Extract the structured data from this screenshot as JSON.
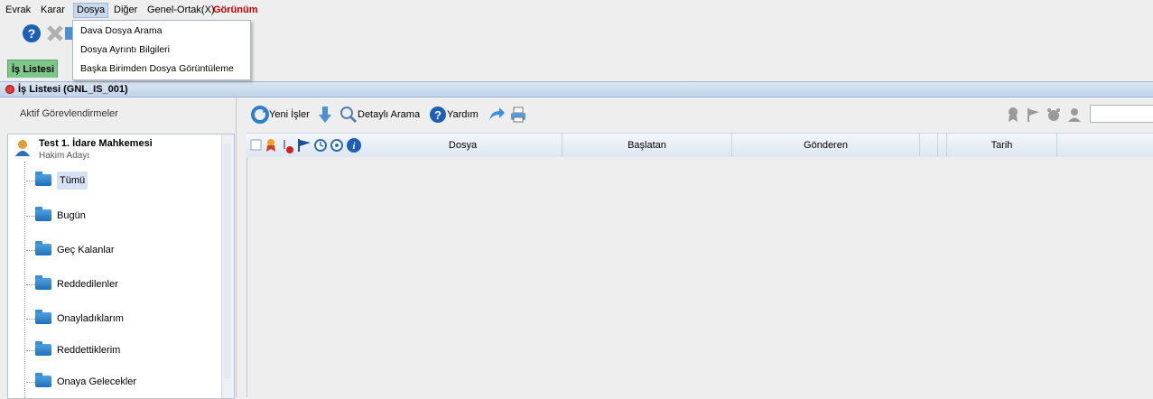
{
  "menu": {
    "items": [
      {
        "label": "Evrak"
      },
      {
        "label": "Karar"
      },
      {
        "label": "Dosya"
      },
      {
        "label": "Diğer"
      },
      {
        "label": "Genel-Ortak(X)"
      },
      {
        "label": "Görünüm"
      }
    ]
  },
  "dropdown": {
    "items": [
      {
        "label": "Dava Dosya Arama"
      },
      {
        "label": "Dosya Ayrıntı Bilgileri"
      },
      {
        "label": "Başka Birimden Dosya Görüntüleme"
      }
    ]
  },
  "tab": {
    "label": "İş Listesi"
  },
  "window": {
    "title": "İş Listesi (GNL_IS_001)"
  },
  "left": {
    "header": "Aktif Görevlendirmeler",
    "root": {
      "title": "Test 1. İdare Mahkemesi",
      "subtitle": "Hakim Adayı"
    },
    "items": [
      {
        "label": "Tümü"
      },
      {
        "label": "Bugün"
      },
      {
        "label": "Geç Kalanlar"
      },
      {
        "label": "Reddedilenler"
      },
      {
        "label": "Onayladıklarım"
      },
      {
        "label": "Reddettiklerim"
      },
      {
        "label": "Onaya Gelecekler"
      }
    ]
  },
  "toolbar": {
    "yeni_isler": "Yeni İşler",
    "detayli_arama": "Detaylı Arama",
    "yardim": "Yardım"
  },
  "table": {
    "columns": [
      "Dosya",
      "Başlatan",
      "Gönderen",
      "Tarih"
    ]
  },
  "colors": {
    "tab_green": "#7ec78a",
    "accent_blue": "#1f6fb8",
    "menu_red": "#d00000"
  }
}
